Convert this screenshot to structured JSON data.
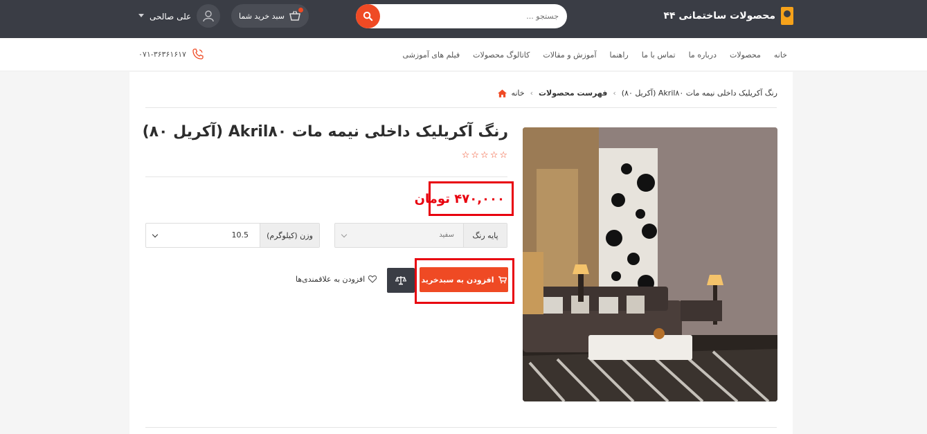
{
  "header": {
    "brand": "محصولات ساختمانی ۴۴",
    "search_placeholder": "جستجو ...",
    "cart_label": "سبد خرید شما",
    "user_name": "علی صالحی"
  },
  "nav": {
    "items": [
      "خانه",
      "محصولات",
      "درباره ما",
      "تماس با ما",
      "راهنما",
      "آموزش و مقالات",
      "کاتالوگ محصولات",
      "فیلم های آموزشی"
    ],
    "phone": "۰۷۱-۳۶۳۶۱۶۱۷"
  },
  "breadcrumb": {
    "home": "خانه",
    "sep": "›",
    "products": "فهرست محصولات",
    "current": "رنگ آکریلیک داخلی نیمه مات Akril۸۰ (آکریل ۸۰)"
  },
  "product": {
    "title": "رنگ آکریلیک داخلی نیمه مات Akril۸۰ (آکریل ۸۰)",
    "rating_stars": 5,
    "rating_filled": 0,
    "price": "۴۷۰,۰۰۰ تومان",
    "color_label": "پایه رنگ",
    "color_value": "سفید",
    "weight_label": "وزن (کیلوگرم)",
    "weight_value": "10.5",
    "add_to_cart": "افزودن به سبدخرید",
    "wishlist": "افزودن به علاقمندی‌ها"
  },
  "colors": {
    "topbar": "#3a3d45",
    "accent": "#ef4a24",
    "highlight": "#e8000e"
  }
}
